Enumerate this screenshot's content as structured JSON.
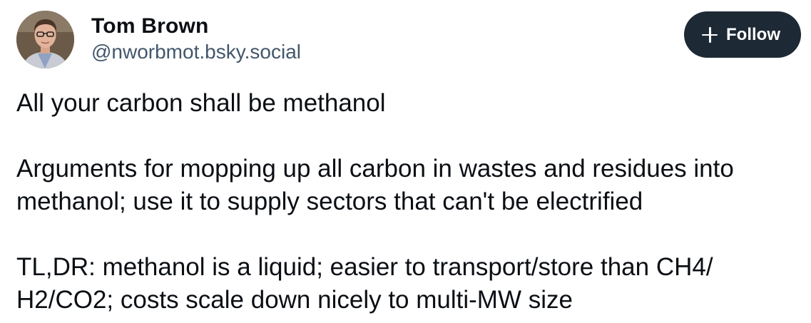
{
  "author": {
    "display_name": "Tom Brown",
    "handle": "@nworbmot.bsky.social",
    "avatar_icon": "user-avatar"
  },
  "actions": {
    "follow_label": "Follow",
    "follow_icon": "plus-icon"
  },
  "post": {
    "paragraphs": [
      "All your carbon shall be methanol",
      "Arguments for mopping up all carbon in wastes and residues into methanol; use it to supply sectors that can't be electrified",
      "TL,DR: methanol is a liquid; easier to transport/store than CH4/ H2/CO2; costs scale down nicely to multi-MW size"
    ]
  },
  "colors": {
    "button_bg": "#1e2936",
    "handle_text": "#42576c",
    "text": "#0b0f14"
  }
}
